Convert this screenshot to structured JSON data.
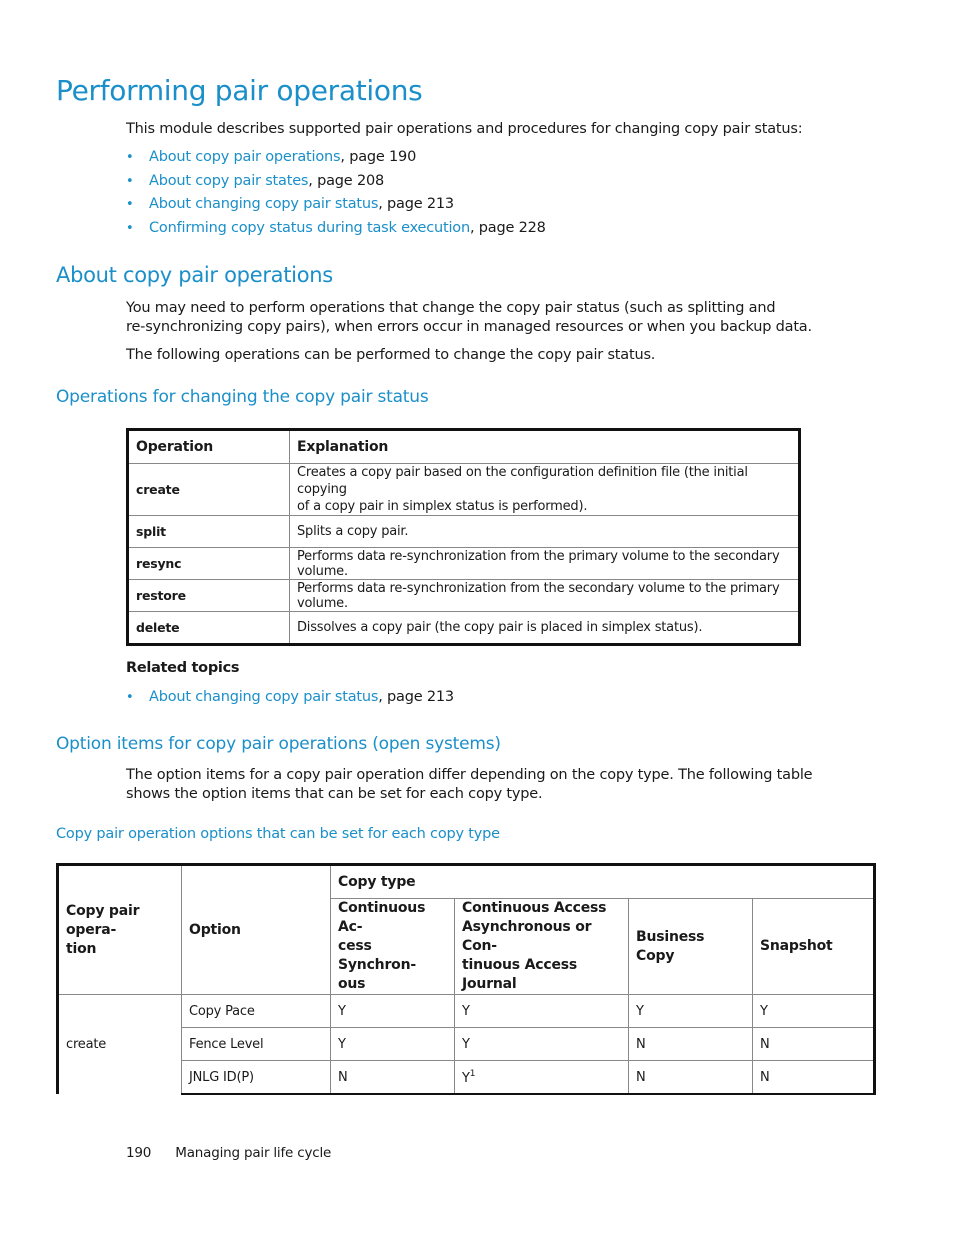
{
  "title": "Performing pair operations",
  "intro": "This module describes supported pair operations and procedures for changing copy pair status:",
  "toc_links": [
    {
      "link": "About copy pair operations",
      "suffix": ", page 190"
    },
    {
      "link": "About copy pair states",
      "suffix": ", page 208"
    },
    {
      "link": "About changing copy pair status",
      "suffix": ", page 213"
    },
    {
      "link": "Confirming copy status during task execution",
      "suffix": ", page 228"
    }
  ],
  "section_about": {
    "heading": "About copy pair operations",
    "para1_line1": "You may need to perform operations that change the copy pair status (such as splitting and",
    "para1_line2": "re-synchronizing copy pairs), when errors occur in managed resources or when you backup data.",
    "para2": "The following operations can be performed to change the copy pair status."
  },
  "section_ops": {
    "heading": "Operations for changing the copy pair status",
    "table": {
      "headers": [
        "Operation",
        "Explanation"
      ],
      "rows": [
        {
          "op": "create",
          "line1": "Creates a copy pair based on the configuration definition file (the initial copying",
          "line2": "of a copy pair in simplex status is performed)."
        },
        {
          "op": "split",
          "line1": "Splits a copy pair."
        },
        {
          "op": "resync",
          "line1": "Performs data re-synchronization from the primary volume to the secondary volume."
        },
        {
          "op": "restore",
          "line1": "Performs data re-synchronization from the secondary volume to the primary volume."
        },
        {
          "op": "delete",
          "line1": "Dissolves a copy pair (the copy pair is placed in simplex status)."
        }
      ]
    },
    "related_title": "Related topics",
    "related_links": [
      {
        "link": "About changing copy pair status",
        "suffix": ", page 213"
      }
    ]
  },
  "section_options": {
    "heading": "Option items for copy pair operations (open systems)",
    "para_line1": "The option items for a copy pair operation differ depending on the copy type. The following table",
    "para_line2": "shows the option items that can be set for each copy type.",
    "table_caption": "Copy pair operation options that can be set for each copy type",
    "table": {
      "col_operation_l1": "Copy pair opera-",
      "col_operation_l2": "tion",
      "col_option": "Option",
      "col_copy_type": "Copy type",
      "copy_types": [
        {
          "l1": "Continuous Ac-",
          "l2": "cess Synchron-",
          "l3": "ous"
        },
        {
          "l1": "Continuous Access",
          "l2": "Asynchronous or Con-",
          "l3": "tinuous Access Journal"
        },
        {
          "l1": "Business Copy",
          "l2": "",
          "l3": ""
        },
        {
          "l1": "Snapshot",
          "l2": "",
          "l3": ""
        }
      ],
      "operation": "create",
      "rows": [
        {
          "option": "Copy Pace",
          "values": [
            "Y",
            "Y",
            "Y",
            "Y"
          ],
          "sup": ""
        },
        {
          "option": "Fence Level",
          "values": [
            "Y",
            "Y",
            "N",
            "N"
          ],
          "sup": ""
        },
        {
          "option": "JNLG ID(P)",
          "values": [
            "N",
            "Y",
            "N",
            "N"
          ],
          "sup": "1"
        }
      ]
    }
  },
  "footer": {
    "page_number": "190",
    "chapter": "Managing pair life cycle"
  },
  "colors": {
    "accent": "#1a8fc9",
    "text": "#1a1a1a"
  }
}
